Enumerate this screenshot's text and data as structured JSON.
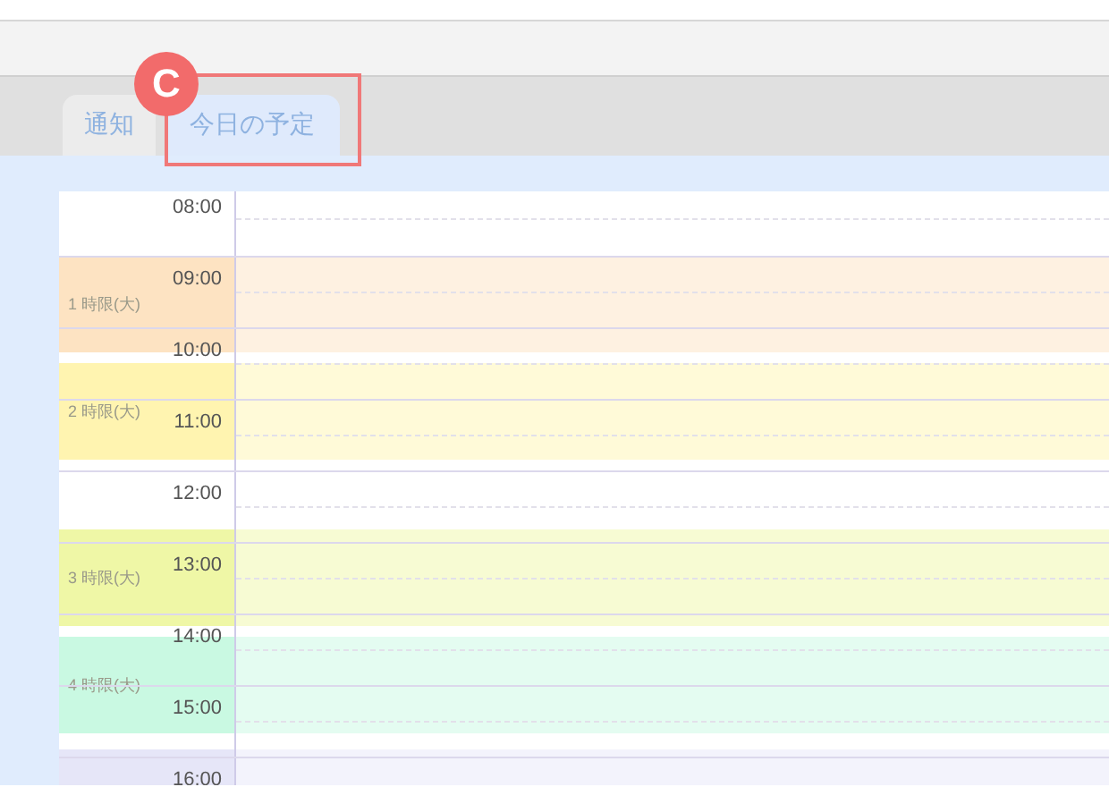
{
  "tabs": [
    {
      "label": "通知",
      "selected": false
    },
    {
      "label": "今日の予定",
      "selected": true
    }
  ],
  "annotation": {
    "label": "C"
  },
  "hours": [
    "08:00",
    "09:00",
    "10:00",
    "11:00",
    "12:00",
    "13:00",
    "14:00",
    "15:00",
    "16:00"
  ],
  "periods": [
    {
      "label": "1 時限(大)",
      "color": "#fde3c2"
    },
    {
      "label": "2 時限(大)",
      "color": "#fff4b0"
    },
    {
      "label": "3 時限(大)",
      "color": "#eff7a6"
    },
    {
      "label": "4 時限(大)",
      "color": "#c9f9e2"
    },
    {
      "color": "#e6e6f8"
    }
  ]
}
